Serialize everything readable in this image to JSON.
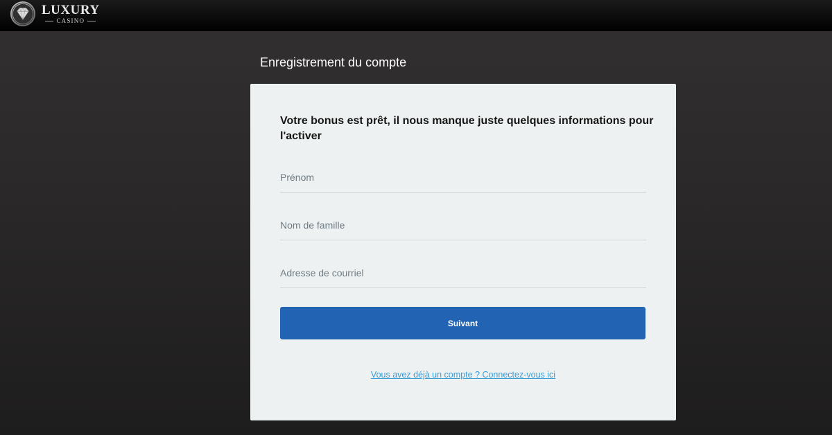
{
  "header": {
    "logo_main": "LUXURY",
    "logo_sub": "CASINO"
  },
  "page": {
    "heading": "Enregistrement du compte"
  },
  "form": {
    "title": "Votre bonus est prêt, il nous manque juste quelques informations pour l'activer",
    "first_name_placeholder": "Prénom",
    "last_name_placeholder": "Nom de famille",
    "email_placeholder": "Adresse de courriel",
    "submit_label": "Suivant",
    "login_link": "Vous avez déjà un compte ? Connectez-vous ici"
  },
  "colors": {
    "primary_button": "#2263b4",
    "link": "#3b9bd4",
    "card_background": "#eef1f1"
  },
  "icons": {
    "logo": "diamond-emblem-icon"
  }
}
